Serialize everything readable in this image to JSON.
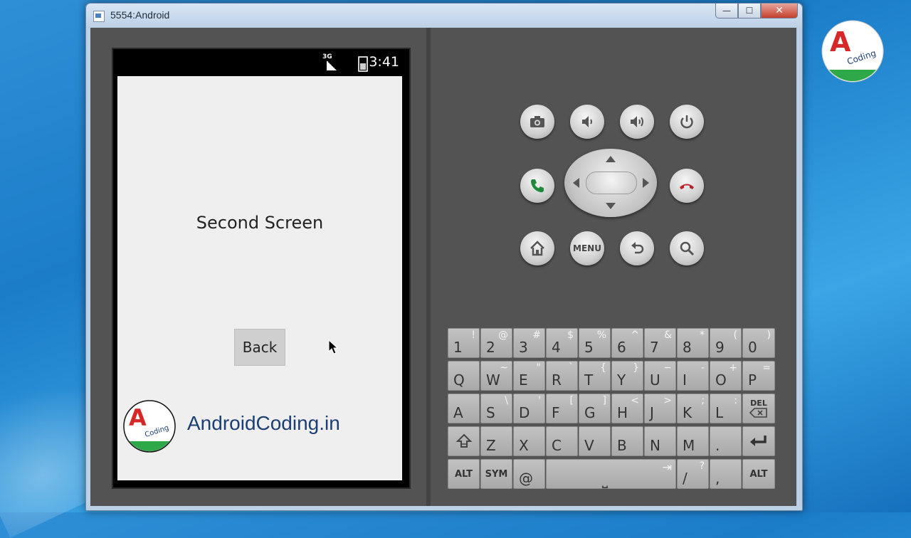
{
  "window": {
    "title": "5554:Android",
    "minimize": "—",
    "maximize": "☐",
    "close": "✕"
  },
  "desktop": {
    "logo_letter": "A",
    "logo_text": "Coding"
  },
  "phone": {
    "status": {
      "network": "3G",
      "time": "3:41"
    },
    "screen_title": "Second Screen",
    "back_button": "Back",
    "brand_logo_letter": "A",
    "brand_logo_text": "Coding",
    "brand_text": "AndroidCoding.in"
  },
  "controls": {
    "menu_label": "MENU"
  },
  "keyboard": {
    "row1": [
      [
        "1",
        "!"
      ],
      [
        "2",
        "@"
      ],
      [
        "3",
        "#"
      ],
      [
        "4",
        "$"
      ],
      [
        "5",
        "%"
      ],
      [
        "6",
        "^"
      ],
      [
        "7",
        "&"
      ],
      [
        "8",
        "*"
      ],
      [
        "9",
        "("
      ],
      [
        "0",
        ")"
      ]
    ],
    "row2": [
      [
        "Q",
        ""
      ],
      [
        "W",
        "~"
      ],
      [
        "E",
        "\""
      ],
      [
        "R",
        "`"
      ],
      [
        "T",
        "{"
      ],
      [
        "Y",
        "}"
      ],
      [
        "U",
        "−"
      ],
      [
        "I",
        "-"
      ],
      [
        "O",
        "+"
      ],
      [
        "P",
        "="
      ]
    ],
    "row3": [
      [
        "A",
        ""
      ],
      [
        "S",
        "\\"
      ],
      [
        "D",
        "'"
      ],
      [
        "F",
        "["
      ],
      [
        "G",
        "]"
      ],
      [
        "H",
        "<"
      ],
      [
        "J",
        ">"
      ],
      [
        "K",
        ";"
      ],
      [
        "L",
        ":"
      ]
    ],
    "del_label": "DEL",
    "row4": [
      [
        "Z",
        ""
      ],
      [
        "X",
        ""
      ],
      [
        "C",
        ""
      ],
      [
        "V",
        ""
      ],
      [
        "B",
        ""
      ],
      [
        "N",
        ""
      ],
      [
        "M",
        ""
      ],
      [
        ".",
        ""
      ]
    ],
    "alt_label": "ALT",
    "sym_label": "SYM",
    "at_label": "@",
    "slash": [
      "/",
      "?"
    ],
    "comma": ",",
    "space_symbol": "⎵",
    "tab_symbol": "⇥"
  },
  "colors": {
    "brand_blue": "#1c3f73",
    "logo_red": "#d62828",
    "logo_green": "#2fa84a"
  }
}
